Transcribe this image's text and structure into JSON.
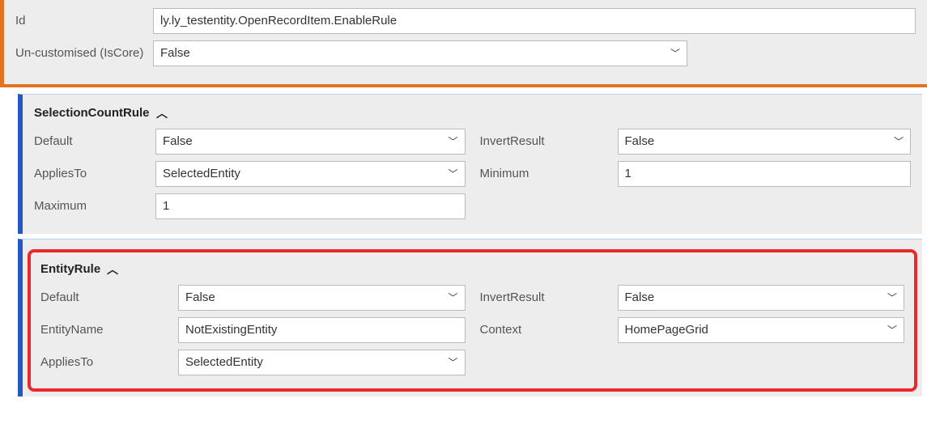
{
  "header": {
    "id_label": "Id",
    "id_value": "ly.ly_testentity.OpenRecordItem.EnableRule",
    "uncustomised_label": "Un-customised (IsCore)",
    "uncustomised_value": "False"
  },
  "selectionCountRule": {
    "title": "SelectionCountRule",
    "default_label": "Default",
    "default_value": "False",
    "invertresult_label": "InvertResult",
    "invertresult_value": "False",
    "appliesto_label": "AppliesTo",
    "appliesto_value": "SelectedEntity",
    "minimum_label": "Minimum",
    "minimum_value": "1",
    "maximum_label": "Maximum",
    "maximum_value": "1"
  },
  "entityRule": {
    "title": "EntityRule",
    "default_label": "Default",
    "default_value": "False",
    "invertresult_label": "InvertResult",
    "invertresult_value": "False",
    "entityname_label": "EntityName",
    "entityname_value": "NotExistingEntity",
    "context_label": "Context",
    "context_value": "HomePageGrid",
    "appliesto_label": "AppliesTo",
    "appliesto_value": "SelectedEntity"
  }
}
